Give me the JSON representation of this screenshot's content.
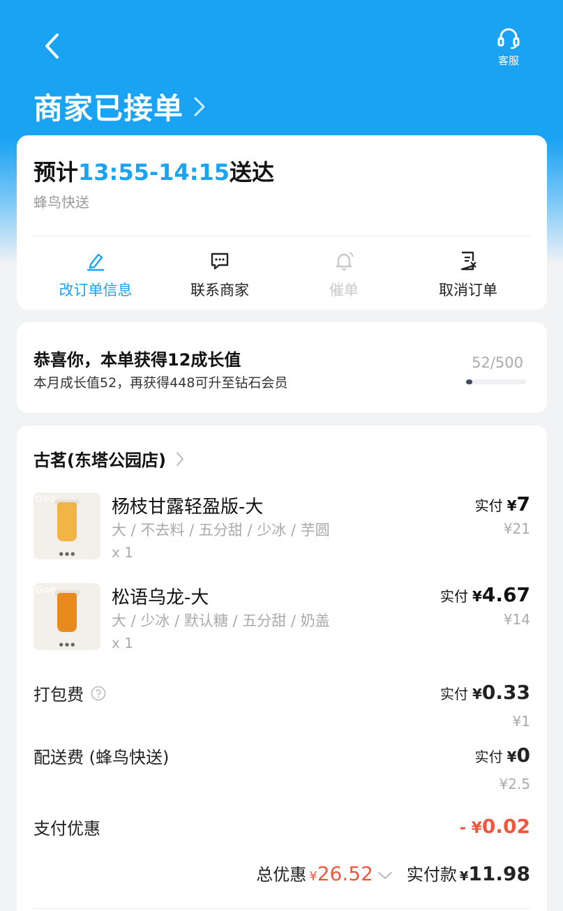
{
  "header": {
    "service_label": "客服",
    "status_title": "商家已接单"
  },
  "eta": {
    "prefix": "预计",
    "time_range": "13:55-14:15",
    "suffix": "送达",
    "carrier": "蜂鸟快送"
  },
  "actions": [
    {
      "label": "改订单信息",
      "icon": "edit-icon",
      "state": "active"
    },
    {
      "label": "联系商家",
      "icon": "chat-icon",
      "state": "normal"
    },
    {
      "label": "催单",
      "icon": "bell-icon",
      "state": "disabled"
    },
    {
      "label": "取消订单",
      "icon": "cancel-order-icon",
      "state": "normal"
    }
  ],
  "growth": {
    "title": "恭喜你，本单获得12成长值",
    "subtitle": "本月成长值52，再获得448可升至钻石会员",
    "progress_text": "52/500",
    "progress_fraction": 0.104
  },
  "order": {
    "shop_name": "古茗(东塔公园店)",
    "items": [
      {
        "name": "杨枝甘露轻盈版-大",
        "spec": "大 / 不去料 / 五分甜 / 少冰 / 芋圆",
        "qty": "x 1",
        "paid_label": "实付",
        "currency": "¥",
        "paid_amount": "7",
        "original": "¥21",
        "cup_color": "#f2b447"
      },
      {
        "name": "松语乌龙-大",
        "spec": "大 / 少冰 / 默认糖 / 五分甜 / 奶盖",
        "qty": "x 1",
        "paid_label": "实付",
        "currency": "¥",
        "paid_amount": "4.67",
        "original": "¥14",
        "cup_color": "#e98a1e"
      }
    ],
    "packing_fee": {
      "label": "打包费",
      "paid_label": "实付",
      "currency": "¥",
      "paid_amount": "0.33",
      "original": "¥1"
    },
    "delivery_fee": {
      "label": "配送费 (蜂鸟快送)",
      "paid_label": "实付",
      "currency": "¥",
      "paid_amount": "0",
      "original": "¥2.5"
    },
    "payment_discount": {
      "label": "支付优惠",
      "prefix": "- ",
      "currency": "¥",
      "amount": "0.02"
    },
    "summary": {
      "total_discount_label": "总优惠",
      "total_discount_currency": "¥",
      "total_discount_amount": "26.52",
      "paid_label": "实付款",
      "paid_currency": "¥",
      "paid_amount": "11.98"
    }
  },
  "colors": {
    "brand_blue": "#1aa3f3",
    "discount_red": "#f0573e"
  }
}
